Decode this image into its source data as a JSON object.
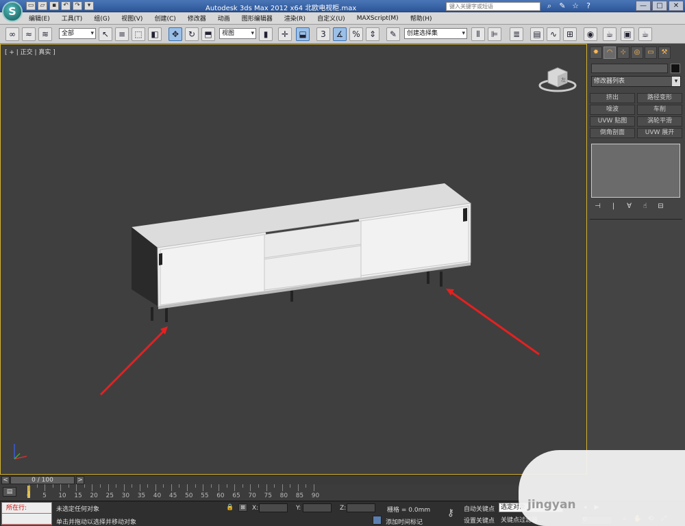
{
  "window": {
    "app_logo": "S",
    "title": "Autodesk 3ds Max  2012 x64    北欧电视柜.max",
    "search_placeholder": "键入关键字或短语",
    "minimize": "—",
    "maximize": "□",
    "close": "✕"
  },
  "menu": [
    "编辑(E)",
    "工具(T)",
    "组(G)",
    "视图(V)",
    "创建(C)",
    "修改器",
    "动画",
    "图形编辑器",
    "渲染(R)",
    "自定义(U)",
    "MAXScript(M)",
    "帮助(H)"
  ],
  "toolbar": {
    "selection_filter": "全部",
    "reference_coord": "视图",
    "snap_label": "3",
    "named_selection": "创建选择集"
  },
  "viewport": {
    "label": "[ + | 正交 | 真实 ]",
    "viewcube_label": "左",
    "colors": {
      "border": "#d7b42f",
      "background": "#3f3f3f",
      "annotation_arrow": "#e62020"
    }
  },
  "command_panel": {
    "modifier_list": "修改器列表",
    "modifiers": [
      "挤出",
      "路径变形",
      "噪波",
      "车削",
      "UVW 贴图",
      "涡轮平滑",
      "倒角剖面",
      "UVW 展开"
    ]
  },
  "timeline": {
    "frame_display": "0 / 100",
    "prev": "<",
    "next": ">",
    "tick_labels": [
      "0",
      "5",
      "10",
      "15",
      "20",
      "25",
      "30",
      "35",
      "40",
      "45",
      "50",
      "55",
      "60",
      "65",
      "70",
      "75",
      "80",
      "85",
      "90"
    ]
  },
  "status": {
    "maxscript_line1": "所在行:",
    "maxscript_line2": "",
    "selection_status": "未选定任何对象",
    "prompt": "单击并拖动以选择并移动对象",
    "x_label": "X:",
    "y_label": "Y:",
    "z_label": "Z:",
    "grid": "栅格 = 0.0mm",
    "add_time_tag": "添加时间标记",
    "auto_key": "自动关键点",
    "set_key": "设置关键点",
    "selected_dropdown": "选定对象",
    "key_filters": "关键点过滤器...",
    "current_frame": "0"
  },
  "watermark": "jingyan"
}
